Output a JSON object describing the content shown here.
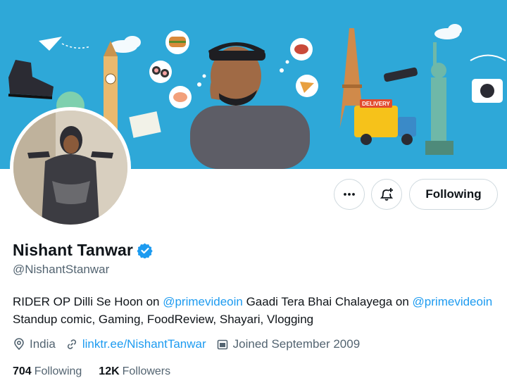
{
  "profile": {
    "display_name": "Nishant Tanwar",
    "handle": "@NishantStanwar",
    "verified": true,
    "bio": {
      "part1": "RIDER OP Dilli Se Hoon on ",
      "mention1": "@primevideoin",
      "part2": " Gaadi Tera Bhai Chalayega on ",
      "mention2": "@primevideoin",
      "part3": " Standup comic, Gaming, FoodReview, Shayari, Vlogging"
    },
    "location": "India",
    "website": "linktr.ee/NishantTanwar",
    "joined": "Joined September 2009"
  },
  "actions": {
    "follow_label": "Following"
  },
  "stats": {
    "following_count": "704",
    "following_label": "Following",
    "followers_count": "12K",
    "followers_label": "Followers"
  },
  "banner": {
    "delivery_label": "DELIVERY"
  },
  "colors": {
    "banner_bg": "#2ea8d8",
    "accent": "#1d9bf0",
    "muted_text": "#536471",
    "border": "#cfd9de"
  },
  "icons": {
    "more": "more-icon",
    "notify": "notification-add-icon",
    "verified": "verified-badge-icon",
    "location": "location-icon",
    "link": "link-icon",
    "calendar": "calendar-icon"
  }
}
